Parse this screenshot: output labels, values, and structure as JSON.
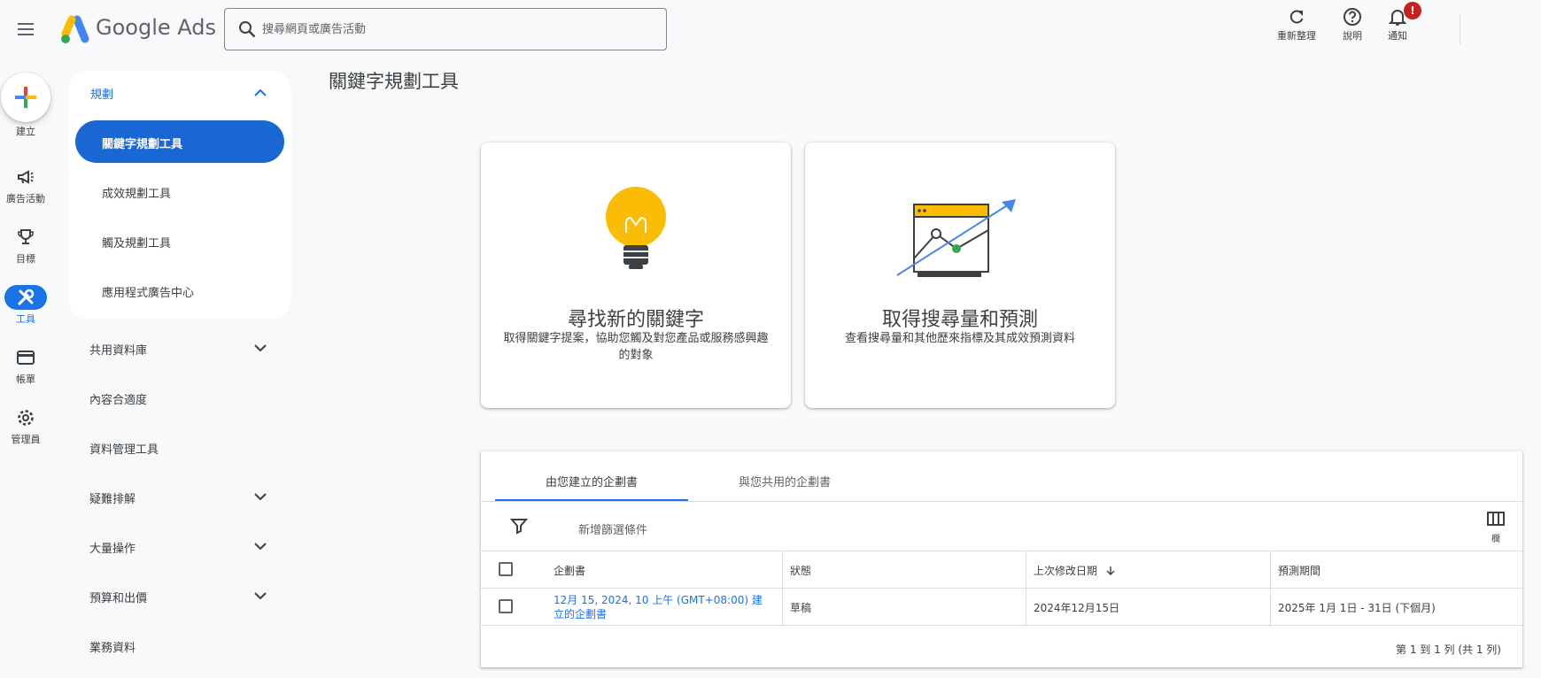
{
  "topbar": {
    "brand": "Google Ads",
    "search_placeholder": "搜尋網頁或廣告活動",
    "refresh_label": "重新整理",
    "help_label": "說明",
    "notifications_label": "通知",
    "notification_badge": "!",
    "badge_color": "#c5221f"
  },
  "rail": {
    "create": "建立",
    "campaigns": "廣告活動",
    "goals": "目標",
    "tools": "工具",
    "billing": "帳單",
    "admin": "管理員"
  },
  "nav": {
    "planning": {
      "label": "規劃",
      "items": [
        {
          "label": "關鍵字規劃工具",
          "active": true
        },
        {
          "label": "成效規劃工具"
        },
        {
          "label": "觸及規劃工具"
        },
        {
          "label": "應用程式廣告中心"
        }
      ]
    },
    "rows": [
      {
        "label": "共用資料庫",
        "expandable": true
      },
      {
        "label": "內容合適度",
        "expandable": false
      },
      {
        "label": "資料管理工具",
        "expandable": false
      },
      {
        "label": "疑難排解",
        "expandable": true
      },
      {
        "label": "大量操作",
        "expandable": true
      },
      {
        "label": "預算和出價",
        "expandable": true
      },
      {
        "label": "業務資料",
        "expandable": false
      }
    ]
  },
  "main": {
    "title": "關鍵字規劃工具",
    "cards": [
      {
        "title": "尋找新的關鍵字",
        "description": "取得關鍵字提案，協助您觸及對您產品或服務感興趣的對象",
        "icon": "lightbulb-icon"
      },
      {
        "title": "取得搜尋量和預測",
        "description": "查看搜尋量和其他歷來指標及其成效預測資料",
        "icon": "forecast-chart-icon"
      }
    ],
    "plans": {
      "tabs": [
        "由您建立的企劃書",
        "與您共用的企劃書"
      ],
      "filter_label": "新增篩選條件",
      "columns_label": "欄",
      "headers": {
        "plan": "企劃書",
        "status": "狀態",
        "modified": "上次修改日期",
        "period": "預測期間"
      },
      "rows": [
        {
          "plan": "12月 15, 2024, 10 上午 (GMT+08:00) 建立的企劃書",
          "status": "草稿",
          "modified": "2024年12月15日",
          "period": "2025年 1月 1日 - 31日 (下個月)"
        }
      ],
      "pagination": "第 1 到 1 列 (共 1 列)"
    }
  },
  "colors": {
    "accent": "#1a73e8",
    "active_nav": "#1967d2",
    "bulb": "#fbbc04",
    "point_green": "#34a853"
  }
}
